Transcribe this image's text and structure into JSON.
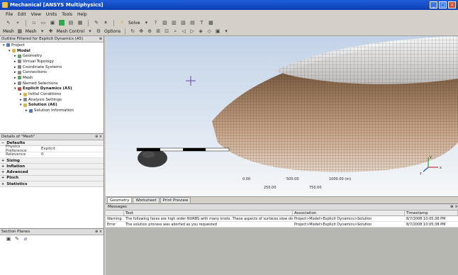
{
  "window": {
    "title": "Mechanical [ANSYS Multiphysics]"
  },
  "menu": [
    "File",
    "Edit",
    "View",
    "Units",
    "Tools",
    "Help"
  ],
  "toolbar1": {
    "solve_label": "Solve"
  },
  "toolbar2": {
    "mesh_label": "Mesh",
    "mesh_dropdown_label": "Mesh",
    "mesh_control_label": "Mesh Control",
    "options_label": "Options"
  },
  "outline": {
    "header": "Outline Filtered for Explicit Dynamics (A5)",
    "items": [
      {
        "label": "Project",
        "level": 0,
        "icon": "blue",
        "bold": false
      },
      {
        "label": "Model",
        "level": 1,
        "icon": "yellow",
        "bold": true
      },
      {
        "label": "Geometry",
        "level": 2,
        "icon": "green",
        "bold": false
      },
      {
        "label": "Virtual Topology",
        "level": 2,
        "icon": "gray",
        "bold": false
      },
      {
        "label": "Coordinate Systems",
        "level": 2,
        "icon": "gray",
        "bold": false
      },
      {
        "label": "Connections",
        "level": 2,
        "icon": "gray",
        "bold": false
      },
      {
        "label": "Mesh",
        "level": 2,
        "icon": "green",
        "bold": false
      },
      {
        "label": "Named Selections",
        "level": 2,
        "icon": "gray",
        "bold": false
      },
      {
        "label": "Explicit Dynamics (A5)",
        "level": 2,
        "icon": "red",
        "bold": true
      },
      {
        "label": "Initial Conditions",
        "level": 3,
        "icon": "yellow",
        "bold": false
      },
      {
        "label": "Analysis Settings",
        "level": 3,
        "icon": "gray",
        "bold": false
      },
      {
        "label": "Solution (A6)",
        "level": 3,
        "icon": "yellow",
        "bold": true
      },
      {
        "label": "Solution Information",
        "level": 4,
        "icon": "blue",
        "bold": false
      }
    ]
  },
  "details": {
    "header": "Details of \"Mesh\"",
    "sections": [
      {
        "title": "Defaults",
        "expanded": true,
        "rows": [
          {
            "key": "Physics Preference",
            "value": "Explicit"
          },
          {
            "key": "Relevance",
            "value": "0"
          }
        ]
      },
      {
        "title": "Sizing",
        "expanded": false,
        "rows": []
      },
      {
        "title": "Inflation",
        "expanded": false,
        "rows": []
      },
      {
        "title": "Advanced",
        "expanded": false,
        "rows": []
      },
      {
        "title": "Pinch",
        "expanded": false,
        "rows": []
      },
      {
        "title": "Statistics",
        "expanded": false,
        "rows": []
      }
    ]
  },
  "section_planes": {
    "header": "Section Planes"
  },
  "viewport": {
    "scale_labels": {
      "zero": "0.00",
      "mid": "500.00",
      "max": "1000.00 (m)",
      "q1": "250.00",
      "q3": "750.00"
    }
  },
  "view_tabs": [
    "Geometry",
    "Worksheet",
    "Print Preview"
  ],
  "messages": {
    "header": "Messages",
    "columns": [
      "",
      "Text",
      "Association",
      "Timestamp"
    ],
    "rows": [
      {
        "type": "Warning",
        "text": "The following faces are high order NURBS with many knots. These aspects of surfaces slow down t",
        "association": "Project>Model>Explicit Dynamics>Solution",
        "timestamp": "8/7/2008 10:05:36 PM"
      },
      {
        "type": "Error",
        "text": "The solution process was aborted as you requested",
        "association": "Project>Model>Explicit Dynamics>Solution",
        "timestamp": "8/7/2008 10:05:38 PM"
      }
    ]
  },
  "colors": {
    "titlebar": "#1f5ed8",
    "mesh_body": "#8a6a4e",
    "projectile": "#3a3a3a"
  }
}
